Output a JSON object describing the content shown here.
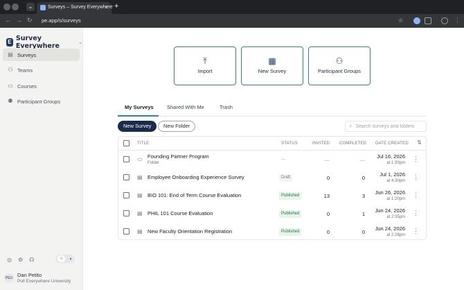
{
  "browser": {
    "tab_title": "Surveys – Survey Everywhere",
    "address": "pe.app/s/surveys",
    "new_tab": "+",
    "close_tab": "×"
  },
  "brand": {
    "name": "Survey Everywhere",
    "mark": "E"
  },
  "sidebar": {
    "items": [
      {
        "label": "Surveys",
        "active": true,
        "icon": "survey-icon"
      },
      {
        "label": "Teams",
        "active": false,
        "icon": "users-icon"
      },
      {
        "label": "Courses",
        "active": false,
        "icon": "book-icon"
      },
      {
        "label": "Participant Groups",
        "active": false,
        "icon": "participant-icon"
      }
    ],
    "footer_icons": [
      "help-icon",
      "settings-icon",
      "support-icon"
    ],
    "user": {
      "initials": "PEU",
      "name": "Dan Petito",
      "org": "Poll Everywhere University"
    }
  },
  "actions": [
    {
      "label": "Import",
      "icon": "upload-icon"
    },
    {
      "label": "New Survey",
      "icon": "clipboard-icon"
    },
    {
      "label": "Participant Groups",
      "icon": "participant-groups-icon"
    }
  ],
  "tabs": [
    {
      "label": "My Surveys",
      "active": true
    },
    {
      "label": "Shared With Me",
      "active": false
    },
    {
      "label": "Trash",
      "active": false
    }
  ],
  "toolbar": {
    "new_survey": "New Survey",
    "new_folder": "New Folder",
    "search_placeholder": "Search surveys and folders"
  },
  "table": {
    "headers": {
      "title": "TITLE",
      "status": "STATUS",
      "invited": "INVITED",
      "completed": "COMPLETED",
      "date_created": "DATE CREATED"
    },
    "rows": [
      {
        "type": "folder",
        "title": "Founding Partner Program",
        "subtitle": "Folder",
        "status": "—",
        "status_kind": "none",
        "invited": "—",
        "completed": "—",
        "date": "Jul 16, 2026",
        "time": "at 1:30pm"
      },
      {
        "type": "survey",
        "title": "Employee Onboarding Experience Survey",
        "subtitle": "",
        "status": "Draft",
        "status_kind": "draft",
        "invited": "0",
        "completed": "0",
        "date": "Jul 1, 2026",
        "time": "at 4:30pm"
      },
      {
        "type": "survey",
        "title": "BIO 101: End of Term Course Evaluation",
        "subtitle": "",
        "status": "Published",
        "status_kind": "published",
        "invited": "13",
        "completed": "3",
        "date": "Jun 26, 2026",
        "time": "at 1:20pm"
      },
      {
        "type": "survey",
        "title": "PHIL 101 Course Evaluation",
        "subtitle": "",
        "status": "Published",
        "status_kind": "published",
        "invited": "0",
        "completed": "1",
        "date": "Jun 24, 2026",
        "time": "at 2:35pm"
      },
      {
        "type": "survey",
        "title": "New Faculty Orientation Registration",
        "subtitle": "",
        "status": "Published",
        "status_kind": "published",
        "invited": "0",
        "completed": "0",
        "date": "Jun 24, 2026",
        "time": "at 2:28pm"
      }
    ]
  },
  "colors": {
    "accent": "#2a8a8f",
    "primary": "#1a2b4c",
    "published_bg": "#e6f4ea",
    "published_fg": "#1e7a3a"
  }
}
